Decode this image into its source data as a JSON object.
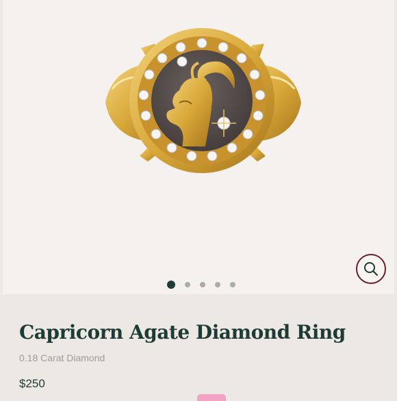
{
  "product": {
    "name": "Capricorn Agate Diamond Ring",
    "subtitle": "0.18 Carat Diamond",
    "price": "$250"
  },
  "gallery": {
    "image_count": 5,
    "active_index": 0,
    "zoom_icon": "search-icon"
  },
  "colors": {
    "brand_dark_green": "#1f3b35",
    "zoom_border": "#6b1f2e",
    "gold": "#d9a93a",
    "page_background": "#ece8e4",
    "image_background": "#f4f1ef",
    "badge_pink": "#f2a2c3"
  }
}
